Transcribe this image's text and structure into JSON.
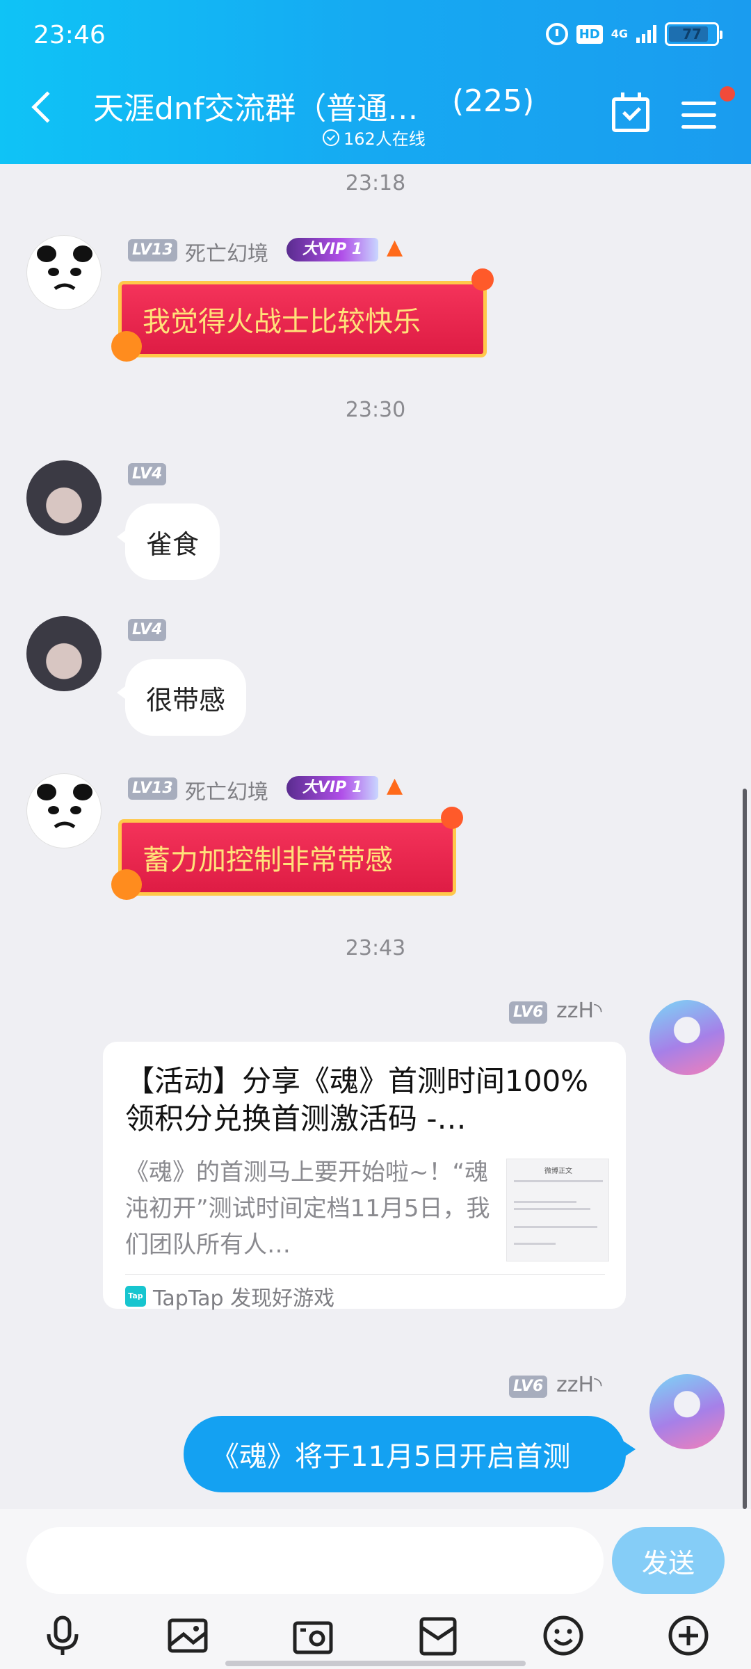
{
  "status_bar": {
    "time": "23:46",
    "network": "4G",
    "hd": "HD",
    "battery": "77"
  },
  "header": {
    "title": "天涯dnf交流群（普通…",
    "member_count": "(225)",
    "online": "162人在线"
  },
  "messages": [
    {
      "type": "timestamp",
      "text": "23:18"
    },
    {
      "type": "banner",
      "sender": "死亡幻境",
      "level": "LV13",
      "vip": "大VIP 1",
      "text": "我觉得火战士比较快乐"
    },
    {
      "type": "timestamp",
      "text": "23:30"
    },
    {
      "type": "bubble",
      "level": "LV4",
      "text": "雀食"
    },
    {
      "type": "bubble",
      "level": "LV4",
      "text": "很带感"
    },
    {
      "type": "banner",
      "sender": "死亡幻境",
      "level": "LV13",
      "vip": "大VIP 1",
      "text": "蓄力加控制非常带感"
    },
    {
      "type": "timestamp",
      "text": "23:43"
    },
    {
      "type": "share",
      "sender": "zzH◝",
      "level": "LV6",
      "title": "【活动】分享《魂》首测时间100%领积分兑换首测激活码 -…",
      "desc": "《魂》的首测马上要开始啦~！“魂沌初开”测试时间定档11月5日，我们团队所有人…",
      "thumb_title": "微博正文",
      "source": "TapTap 发现好游戏",
      "source_logo": "Tap"
    },
    {
      "type": "self",
      "sender": "zzH◝",
      "level": "LV6",
      "text": "《魂》将于11月5日开启首测"
    }
  ],
  "input": {
    "placeholder": "",
    "send_label": "发送"
  },
  "toolbar": [
    "mic-icon",
    "image-icon",
    "camera-icon",
    "folder-icon",
    "emoji-icon",
    "plus-icon"
  ],
  "colors": {
    "accent": "#14a1f2",
    "banner_red": "#e8244b",
    "banner_gold": "#ffc84a"
  }
}
